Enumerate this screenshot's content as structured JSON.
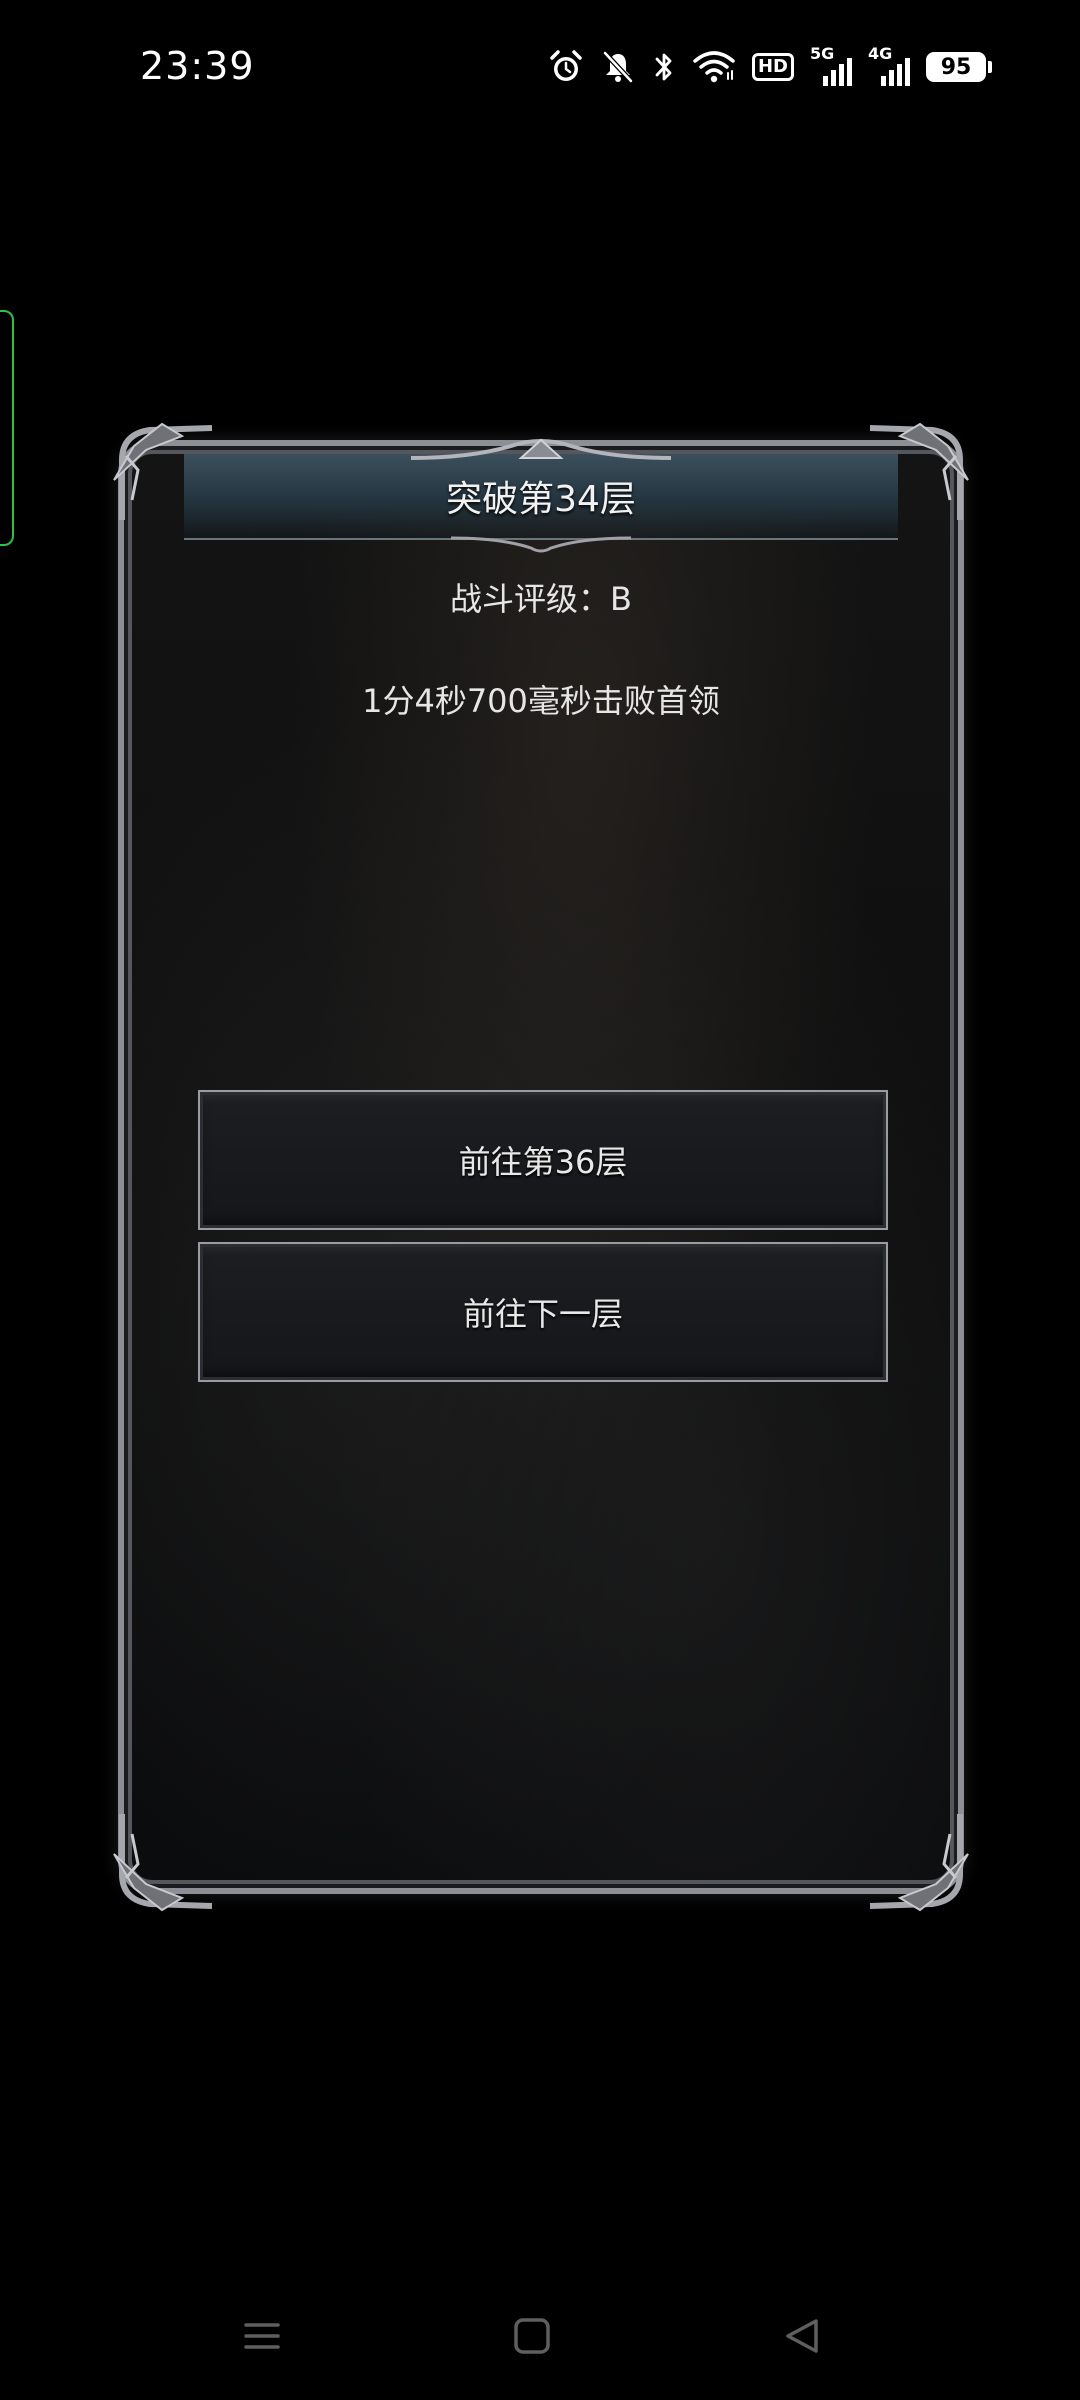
{
  "status_bar": {
    "time": "23:39",
    "hd_label": "HD",
    "network_1": "5G",
    "network_2": "4G",
    "battery": "95",
    "icons": [
      "alarm-icon",
      "mute-icon",
      "bluetooth-icon",
      "wifi-icon",
      "hd-icon",
      "signal-5g-icon",
      "signal-4g-icon",
      "battery-icon"
    ]
  },
  "dialog": {
    "title": "突破第34层",
    "rating_label": "战斗评级：",
    "rating_value": "B",
    "result_text": "1分4秒700毫秒击败首领",
    "buttons": {
      "goto_floor": "前往第36层",
      "next_floor": "前往下一层"
    }
  },
  "nav_bar": {
    "icons": [
      "menu-icon",
      "home-icon",
      "back-icon"
    ]
  },
  "colors": {
    "background": "#000000",
    "title_bar": "#2b3d49",
    "text": "#e6e6e6",
    "side_handle": "#2fbf4b",
    "frame": "#8d8f95"
  }
}
